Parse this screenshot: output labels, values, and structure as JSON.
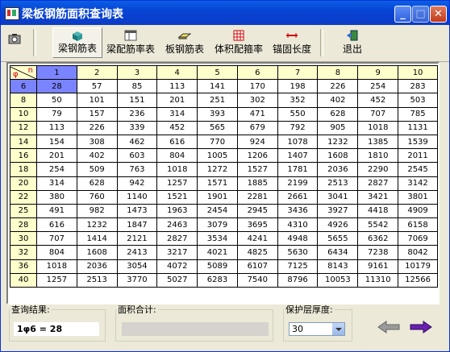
{
  "window": {
    "title": "梁板钢筋面积查询表"
  },
  "toolbar": {
    "items": [
      {
        "label": "梁钢筋表",
        "icon": "cube-icon"
      },
      {
        "label": "梁配筋率表",
        "icon": "table-icon"
      },
      {
        "label": "板钢筋表",
        "icon": "plate-icon"
      },
      {
        "label": "体积配箍率",
        "icon": "grid-icon"
      },
      {
        "label": "锚固长度",
        "icon": "ruler-icon"
      },
      {
        "label": "退出",
        "icon": "exit-door-icon"
      }
    ]
  },
  "table": {
    "corner_top": "n",
    "corner_bottom": "φ",
    "columns": [
      "1",
      "2",
      "3",
      "4",
      "5",
      "6",
      "7",
      "8",
      "9",
      "10"
    ],
    "rows": [
      {
        "d": "6",
        "v": [
          "28",
          "57",
          "85",
          "113",
          "141",
          "170",
          "198",
          "226",
          "254",
          "283"
        ]
      },
      {
        "d": "8",
        "v": [
          "50",
          "101",
          "151",
          "201",
          "251",
          "302",
          "352",
          "402",
          "452",
          "503"
        ]
      },
      {
        "d": "10",
        "v": [
          "79",
          "157",
          "236",
          "314",
          "393",
          "471",
          "550",
          "628",
          "707",
          "785"
        ]
      },
      {
        "d": "12",
        "v": [
          "113",
          "226",
          "339",
          "452",
          "565",
          "679",
          "792",
          "905",
          "1018",
          "1131"
        ]
      },
      {
        "d": "14",
        "v": [
          "154",
          "308",
          "462",
          "616",
          "770",
          "924",
          "1078",
          "1232",
          "1385",
          "1539"
        ]
      },
      {
        "d": "16",
        "v": [
          "201",
          "402",
          "603",
          "804",
          "1005",
          "1206",
          "1407",
          "1608",
          "1810",
          "2011"
        ]
      },
      {
        "d": "18",
        "v": [
          "254",
          "509",
          "763",
          "1018",
          "1272",
          "1527",
          "1781",
          "2036",
          "2290",
          "2545"
        ]
      },
      {
        "d": "20",
        "v": [
          "314",
          "628",
          "942",
          "1257",
          "1571",
          "1885",
          "2199",
          "2513",
          "2827",
          "3142"
        ]
      },
      {
        "d": "22",
        "v": [
          "380",
          "760",
          "1140",
          "1521",
          "1901",
          "2281",
          "2661",
          "3041",
          "3421",
          "3801"
        ]
      },
      {
        "d": "25",
        "v": [
          "491",
          "982",
          "1473",
          "1963",
          "2454",
          "2945",
          "3436",
          "3927",
          "4418",
          "4909"
        ]
      },
      {
        "d": "28",
        "v": [
          "616",
          "1232",
          "1847",
          "2463",
          "3079",
          "3695",
          "4310",
          "4926",
          "5542",
          "6158"
        ]
      },
      {
        "d": "30",
        "v": [
          "707",
          "1414",
          "2121",
          "2827",
          "3534",
          "4241",
          "4948",
          "5655",
          "6362",
          "7069"
        ]
      },
      {
        "d": "32",
        "v": [
          "804",
          "1608",
          "2413",
          "3217",
          "4021",
          "4825",
          "5630",
          "6434",
          "7238",
          "8042"
        ]
      },
      {
        "d": "36",
        "v": [
          "1018",
          "2036",
          "3054",
          "4072",
          "5089",
          "6107",
          "7125",
          "8143",
          "9161",
          "10179"
        ]
      },
      {
        "d": "40",
        "v": [
          "1257",
          "2513",
          "3770",
          "5027",
          "6283",
          "7540",
          "8796",
          "10053",
          "11310",
          "12566"
        ]
      }
    ]
  },
  "query": {
    "label": "查询结果:",
    "value": "1φ6 = 28"
  },
  "area_total": {
    "label": "面积合计:",
    "value": ""
  },
  "cover": {
    "label": "保护层厚度:",
    "value": "30"
  },
  "colors": {
    "selected": "#7b84ff",
    "header": "#ffffcc"
  }
}
